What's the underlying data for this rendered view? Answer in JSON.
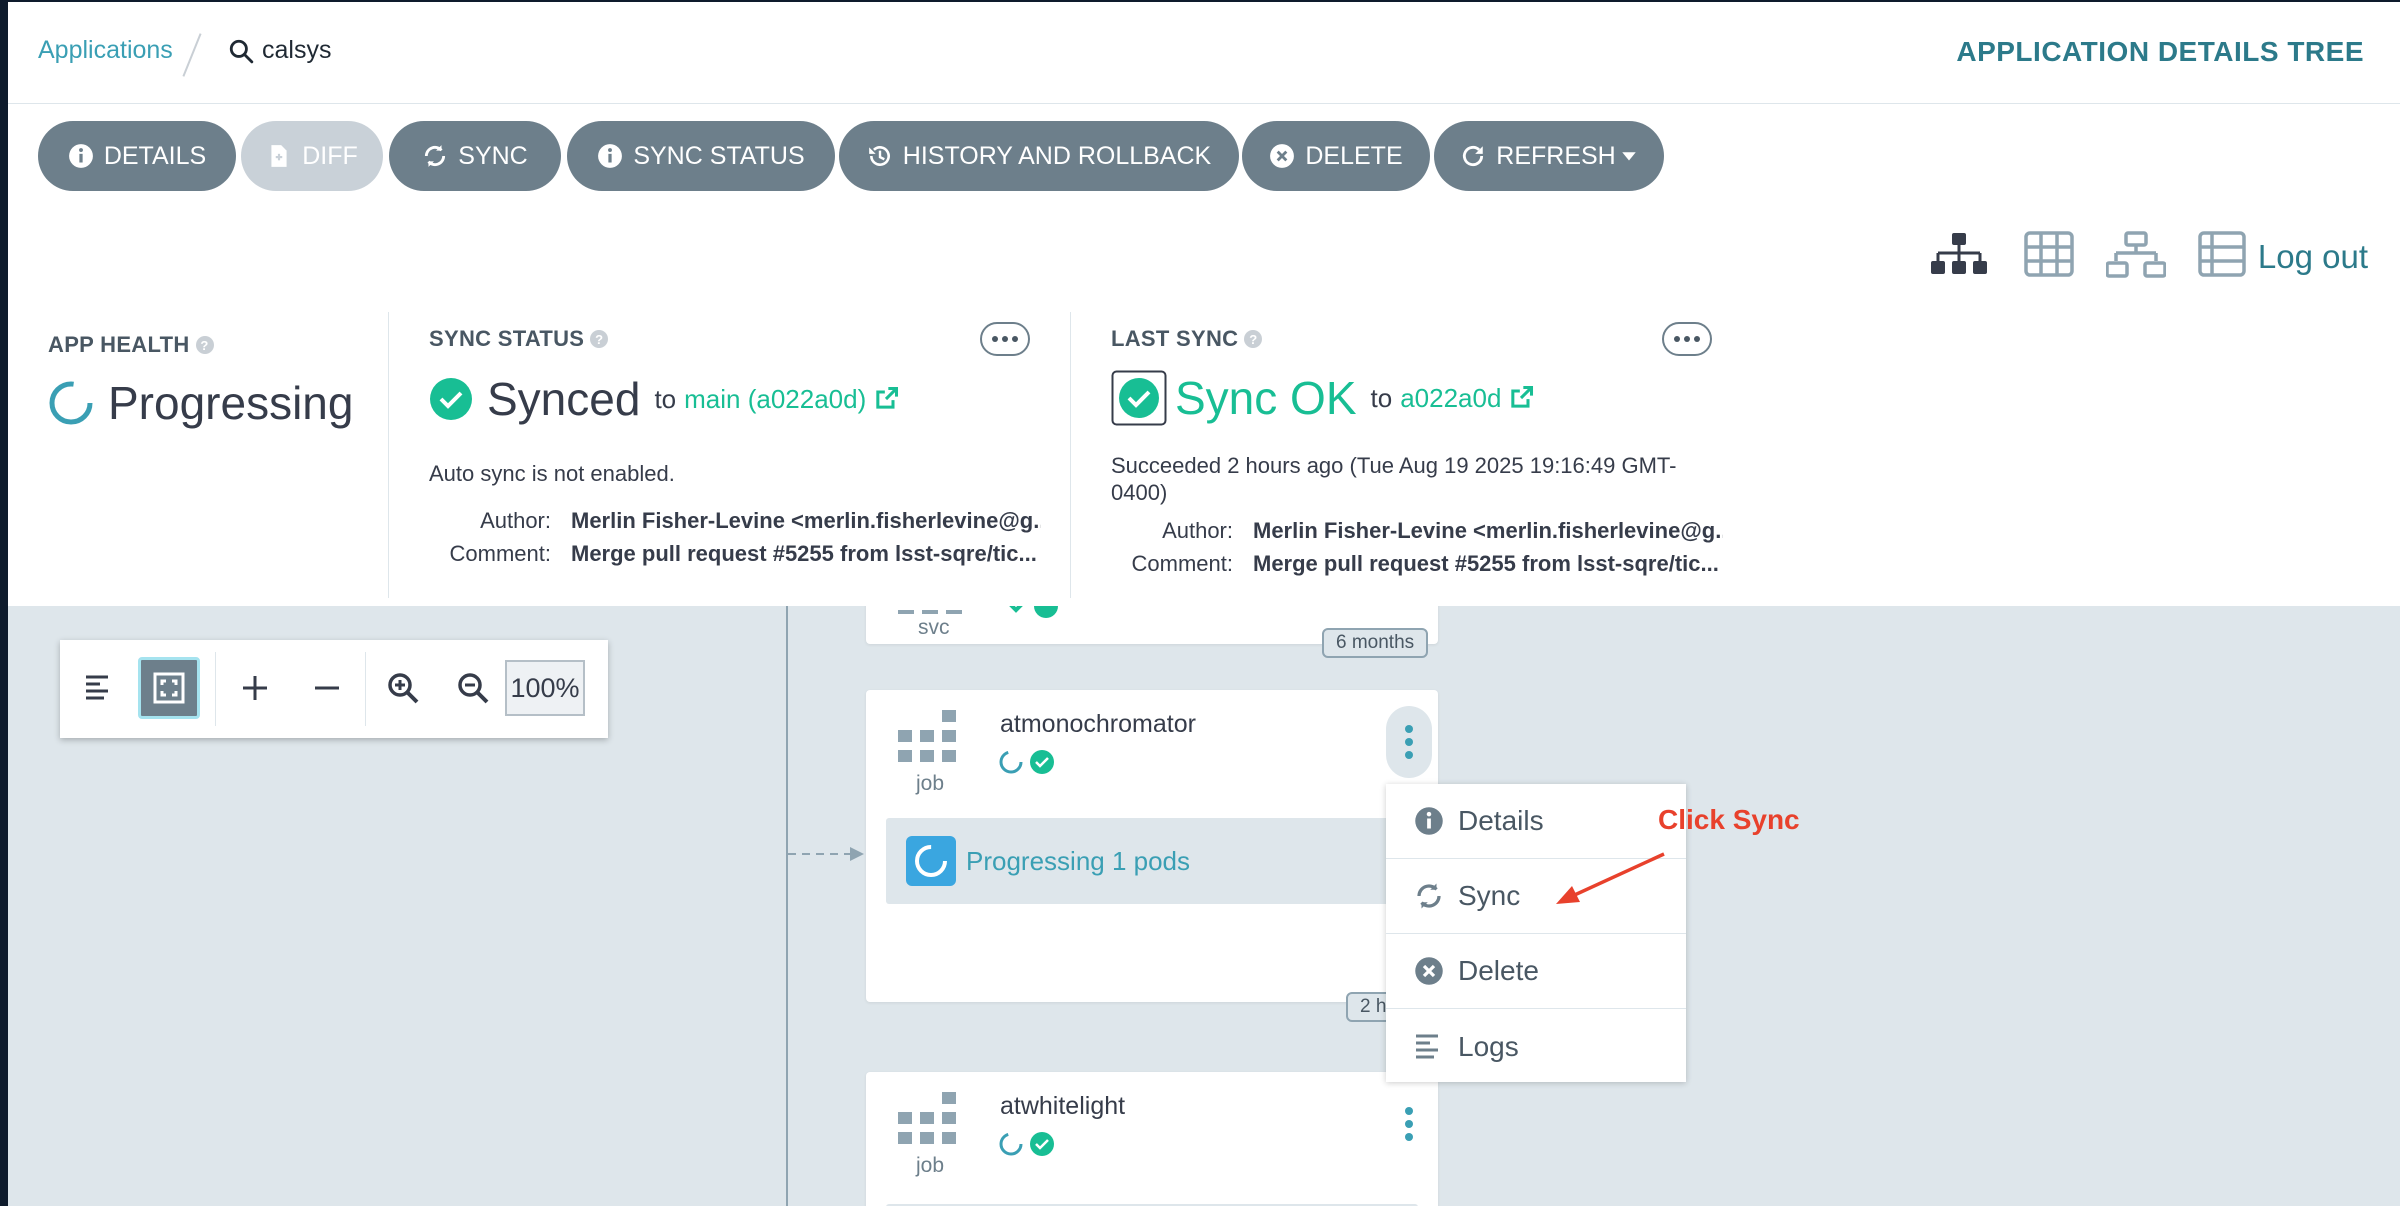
{
  "breadcrumb": {
    "root": "Applications",
    "app": "calsys"
  },
  "view_title": "APPLICATION DETAILS TREE",
  "toolbar": {
    "buttons": [
      {
        "label": "DETAILS",
        "icon": "info-icon"
      },
      {
        "label": "DIFF",
        "icon": "file-diff-icon",
        "disabled": true
      },
      {
        "label": "SYNC",
        "icon": "sync-icon"
      },
      {
        "label": "SYNC STATUS",
        "icon": "info-icon"
      },
      {
        "label": "HISTORY AND ROLLBACK",
        "icon": "history-icon"
      },
      {
        "label": "DELETE",
        "icon": "times-circle-icon"
      },
      {
        "label": "REFRESH",
        "icon": "refresh-icon",
        "dropdown": true
      }
    ]
  },
  "view_icons": [
    "tree-view-icon",
    "pods-view-icon",
    "network-view-icon",
    "list-view-icon"
  ],
  "logout": "Log out",
  "app_health": {
    "title": "APP HEALTH",
    "status": "Progressing"
  },
  "sync_status": {
    "title": "SYNC STATUS",
    "status": "Synced",
    "to": "to",
    "revision": "main (a022a0d)",
    "auto_sync": "Auto sync is not enabled.",
    "author_label": "Author:",
    "author": "Merlin Fisher-Levine <merlin.fisherlevine@g...",
    "comment_label": "Comment:",
    "comment": "Merge pull request #5255 from lsst-sqre/tic..."
  },
  "last_sync": {
    "title": "LAST SYNC",
    "status": "Sync OK",
    "to": "to",
    "revision": "a022a0d",
    "succeeded": "Succeeded 2 hours ago (Tue Aug 19 2025 19:16:49 GMT-0400)",
    "author_label": "Author:",
    "author": "Merlin Fisher-Levine <merlin.fisherlevine@g...",
    "comment_label": "Comment:",
    "comment": "Merge pull request #5255 from lsst-sqre/tic..."
  },
  "zoom": {
    "level": "100%"
  },
  "nodes": [
    {
      "kind": "svc",
      "age": "6 months"
    },
    {
      "title": "atmonochromator",
      "kind": "job",
      "pods": "Progressing 1 pods",
      "age": "2 h"
    },
    {
      "title": "atwhitelight",
      "kind": "job"
    }
  ],
  "context_menu": {
    "items": [
      {
        "label": "Details",
        "icon": "info-icon"
      },
      {
        "label": "Sync",
        "icon": "sync-icon"
      },
      {
        "label": "Delete",
        "icon": "times-circle-icon"
      },
      {
        "label": "Logs",
        "icon": "logs-icon"
      }
    ]
  },
  "annotation": "Click Sync",
  "colors": {
    "accent": "#3a9fb4",
    "healthy_green": "#18be94",
    "button_gray": "#6d7f8b",
    "annotation_red": "#e8412c"
  }
}
